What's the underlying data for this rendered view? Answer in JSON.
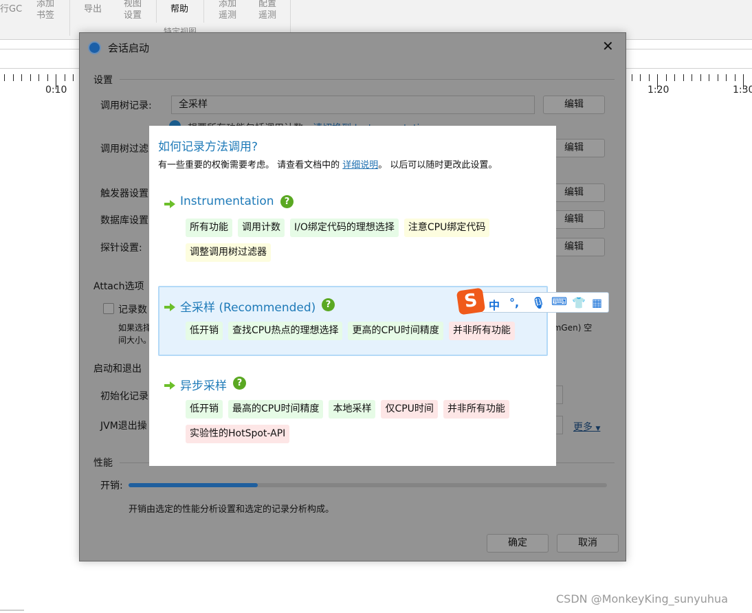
{
  "ribbon": {
    "items": [
      {
        "label": "行GC"
      },
      {
        "label": "添加\n书签"
      },
      {
        "label": "导出"
      },
      {
        "label": "视图\n设置"
      },
      {
        "label": "帮助"
      },
      {
        "label": "添加\n遥测"
      },
      {
        "label": "配置\n遥测"
      }
    ],
    "group_label": "特定视图"
  },
  "timeline": {
    "labels": [
      "0:10",
      "1:20",
      "1:30"
    ]
  },
  "dialog": {
    "title": "会话启动",
    "sections": {
      "settings": "设置",
      "attach": "Attach选项",
      "startup": "启动和退出",
      "performance": "性能"
    },
    "call_tree_recording": {
      "label": "调用树记录:",
      "value": "全采样",
      "edit": "编辑"
    },
    "info": {
      "text": "想要所有功能包括调用计数，",
      "link": "请切换到 Instrumentation"
    },
    "call_tree_filter": {
      "label": "调用树过滤",
      "edit": "编辑"
    },
    "trigger": {
      "label": "触发器设置",
      "edit": "编辑"
    },
    "database": {
      "label": "数据库设置",
      "edit": "编辑"
    },
    "probe": {
      "label": "探针设置:",
      "edit": "编辑"
    },
    "attach_checkbox": {
      "label": "记录数",
      "checked": false
    },
    "attach_note": {
      "line1": "如果选择",
      "line1_end": "rmGen) 空",
      "line2": "间大小。"
    },
    "init_recording": {
      "label": "初始化记录"
    },
    "jvm_exit": {
      "label": "JVM退出操",
      "more": "更多"
    },
    "overhead": {
      "label": "开销:",
      "value_percent": 27,
      "color": "#1f5f9e",
      "description": "开销由选定的性能分析设置和选定的记录分析构成。"
    },
    "ok": "确定",
    "cancel": "取消"
  },
  "popup": {
    "title": "如何记录方法调用?",
    "subtitle_before": "有一些重要的权衡需要考虑。 请查看文档中的 ",
    "subtitle_link": "详细说明",
    "subtitle_after": "。 以后可以随时更改此设置。",
    "options": [
      {
        "name": "Instrumentation",
        "selected": false,
        "tags": [
          {
            "text": "所有功能",
            "kind": "g"
          },
          {
            "text": "调用计数",
            "kind": "g"
          },
          {
            "text": "I/O绑定代码的理想选择",
            "kind": "g"
          },
          {
            "text": "注意CPU绑定代码",
            "kind": "y"
          },
          {
            "text": "调整调用树过滤器",
            "kind": "y"
          }
        ]
      },
      {
        "name": "全采样 (Recommended)",
        "selected": true,
        "tags": [
          {
            "text": "低开销",
            "kind": "g"
          },
          {
            "text": "查找CPU热点的理想选择",
            "kind": "g"
          },
          {
            "text": "更高的CPU时间精度",
            "kind": "g"
          },
          {
            "text": "并非所有功能",
            "kind": "r"
          }
        ]
      },
      {
        "name": "异步采样",
        "selected": false,
        "tags": [
          {
            "text": "低开销",
            "kind": "g"
          },
          {
            "text": "最高的CPU时间精度",
            "kind": "g"
          },
          {
            "text": "本地采样",
            "kind": "g"
          },
          {
            "text": "仅CPU时间",
            "kind": "r"
          },
          {
            "text": "并非所有功能",
            "kind": "r"
          },
          {
            "text": "实验性的HotSpot-API",
            "kind": "r"
          }
        ]
      }
    ],
    "help_icon": "?"
  },
  "ime": {
    "logo": "S",
    "items": [
      "中",
      "°,",
      "mic-icon",
      "keyboard-icon",
      "shirt-icon",
      "apps-icon"
    ]
  },
  "watermark": "CSDN @MonkeyKing_sunyuhua",
  "colors": {
    "accent": "#1e7ab8",
    "tag_green": "#e6fbe6",
    "tag_yellow": "#fdfddf",
    "tag_red": "#fde6e6",
    "dim": "#939393"
  }
}
